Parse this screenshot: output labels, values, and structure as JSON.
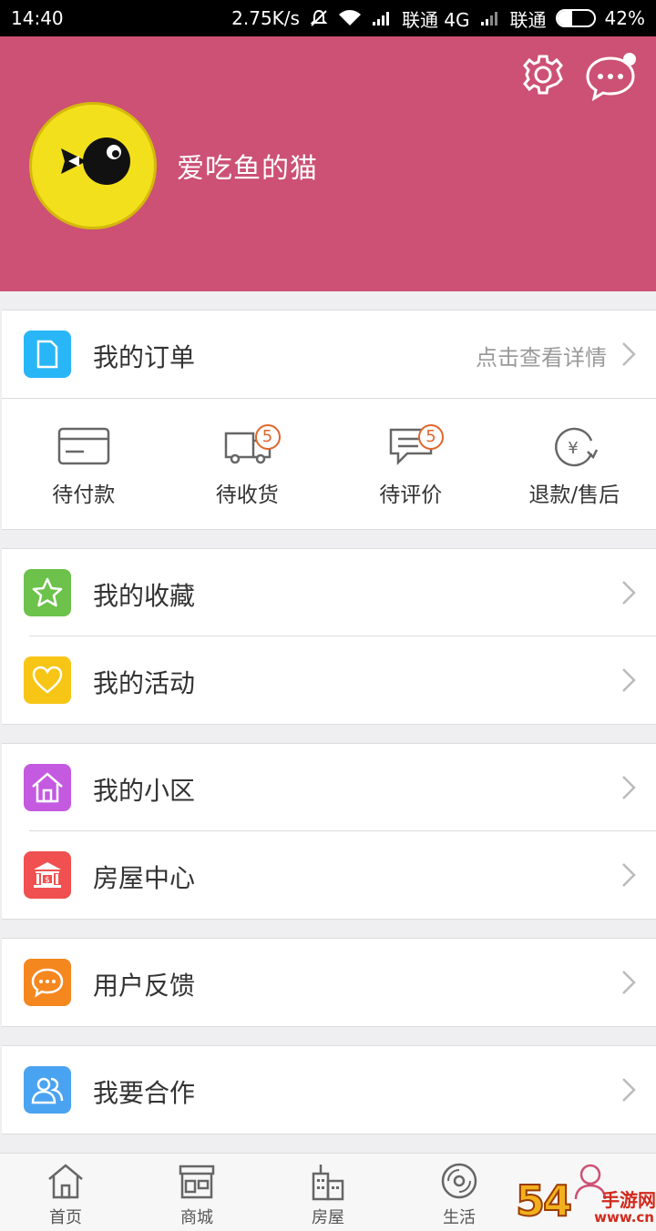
{
  "status_bar": {
    "time": "14:40",
    "speed": "2.75K/s",
    "carrier1": "联通 4G",
    "carrier2": "联通",
    "battery": "42%",
    "battery_level": 0.42
  },
  "profile": {
    "nickname": "爱吃鱼的猫"
  },
  "orders": {
    "title": "我的订单",
    "hint": "点击查看详情",
    "items": [
      {
        "label": "待付款",
        "icon": "card-icon"
      },
      {
        "label": "待收货",
        "icon": "truck-icon",
        "badge": "5"
      },
      {
        "label": "待评价",
        "icon": "comment-icon",
        "badge": "5"
      },
      {
        "label": "退款/售后",
        "icon": "refund-icon"
      }
    ]
  },
  "menu": {
    "favorites": "我的收藏",
    "activities": "我的活动",
    "community": "我的小区",
    "housing_center": "房屋中心",
    "feedback": "用户反馈",
    "cooperation": "我要合作"
  },
  "colors": {
    "header_bg": "#cc5174",
    "orders_icon": "#29b6f6",
    "favorites_icon": "#6cc24a",
    "activities_icon": "#f7c515",
    "community_icon": "#c45ae0",
    "housing_icon": "#f05050",
    "feedback_icon": "#f5871f",
    "cooperation_icon": "#4aa3f0"
  },
  "tabbar": {
    "home": "首页",
    "mall": "商城",
    "housing": "房屋",
    "life": "生活"
  },
  "watermark": {
    "text": "54",
    "brand": "手游网",
    "url": "www.cn"
  }
}
